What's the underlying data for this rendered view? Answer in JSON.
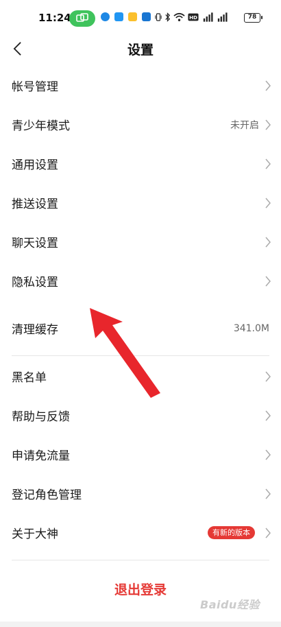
{
  "status_bar": {
    "time": "11:24",
    "battery": "78",
    "icons": [
      "screen-cast-icon",
      "app-icon-blue",
      "app-icon-blue-2",
      "app-icon-yellow",
      "app-icon-infinity",
      "vibrate-icon",
      "bluetooth-icon",
      "wifi-icon",
      "hd-icon",
      "signal-icon",
      "signal-icon-2",
      "battery-icon"
    ]
  },
  "header": {
    "title": "设置",
    "back_icon": "chevron-left-icon"
  },
  "settings": {
    "items": [
      {
        "label": "帐号管理",
        "value": "",
        "arrow": true
      },
      {
        "label": "青少年模式",
        "value": "未开启",
        "arrow": true
      },
      {
        "label": "通用设置",
        "value": "",
        "arrow": true
      },
      {
        "label": "推送设置",
        "value": "",
        "arrow": true
      },
      {
        "label": "聊天设置",
        "value": "",
        "arrow": true
      },
      {
        "label": "隐私设置",
        "value": "",
        "arrow": true
      },
      {
        "label": "清理缓存",
        "value": "341.0M",
        "arrow": false
      },
      {
        "label": "黑名单",
        "value": "",
        "arrow": true
      },
      {
        "label": "帮助与反馈",
        "value": "",
        "arrow": true
      },
      {
        "label": "申请免流量",
        "value": "",
        "arrow": true
      },
      {
        "label": "登记角色管理",
        "value": "",
        "arrow": true
      },
      {
        "label": "关于大神",
        "badge": "有新的版本",
        "arrow": true
      }
    ]
  },
  "logout_label": "退出登录",
  "watermark": "Baidu经验",
  "colors": {
    "accent_red": "#e53935",
    "pill_green": "#3fc35c",
    "annotation_arrow": "#e8262c"
  }
}
